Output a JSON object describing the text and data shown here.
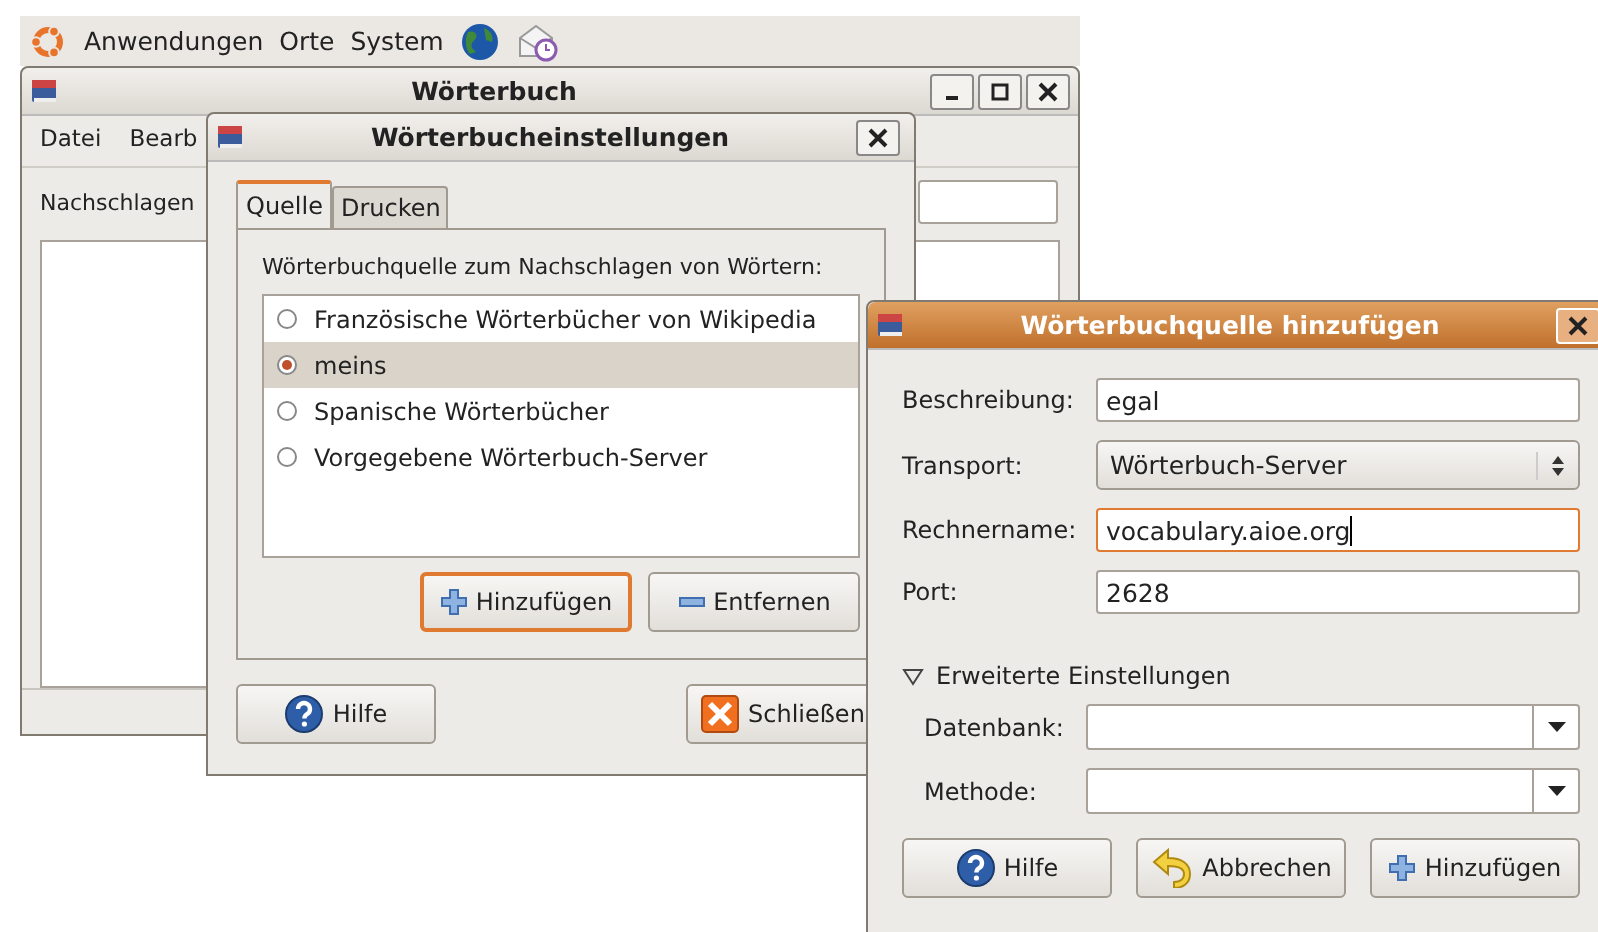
{
  "top_panel": {
    "menus": [
      "Anwendungen",
      "Orte",
      "System"
    ]
  },
  "main_window": {
    "title": "Wörterbuch",
    "active": false,
    "menu": [
      "Datei",
      "Bearb"
    ],
    "lookup_label": "Nachschlagen"
  },
  "settings_dialog": {
    "title": "Wörterbucheinstellungen",
    "active": false,
    "tabs": [
      {
        "label": "Quelle",
        "selected": true
      },
      {
        "label": "Drucken",
        "selected": false
      }
    ],
    "sources_label": "Wörterbuchquelle zum Nachschlagen von Wörtern:",
    "sources": [
      {
        "label": "Französische Wörterbücher von Wikipedia",
        "selected": false
      },
      {
        "label": "meins",
        "selected": true
      },
      {
        "label": "Spanische Wörterbücher",
        "selected": false
      },
      {
        "label": "Vorgegebene Wörterbuch-Server",
        "selected": false
      }
    ],
    "list_buttons": [
      {
        "label": "Hinzufügen",
        "kind": "add",
        "focused": true
      },
      {
        "label": "Entfernen",
        "kind": "remove",
        "focused": false
      }
    ],
    "footer_buttons": [
      {
        "label": "Hilfe",
        "kind": "help"
      },
      {
        "label": "Schließen",
        "kind": "close"
      }
    ]
  },
  "add_dialog": {
    "title": "Wörterbuchquelle hinzufügen",
    "active": true,
    "fields": [
      {
        "label": "Beschreibung:",
        "kind": "entry",
        "value": "egal",
        "focused": false
      },
      {
        "label": "Transport:",
        "kind": "select",
        "value": "Wörterbuch-Server",
        "focused": false
      },
      {
        "label": "Rechnername:",
        "kind": "entry",
        "value": "vocabulary.aioe.org",
        "focused": true
      },
      {
        "label": "Port:",
        "kind": "entry",
        "value": "2628",
        "focused": false
      }
    ],
    "advanced": {
      "label": "Erweiterte Einstellungen",
      "expanded": true,
      "fields": [
        {
          "label": "Datenbank:",
          "kind": "combo"
        },
        {
          "label": "Methode:",
          "kind": "combo"
        }
      ]
    },
    "buttons": [
      {
        "label": "Hilfe",
        "kind": "help"
      },
      {
        "label": "Abbrechen",
        "kind": "cancel"
      },
      {
        "label": "Hinzufügen",
        "kind": "add"
      }
    ]
  }
}
